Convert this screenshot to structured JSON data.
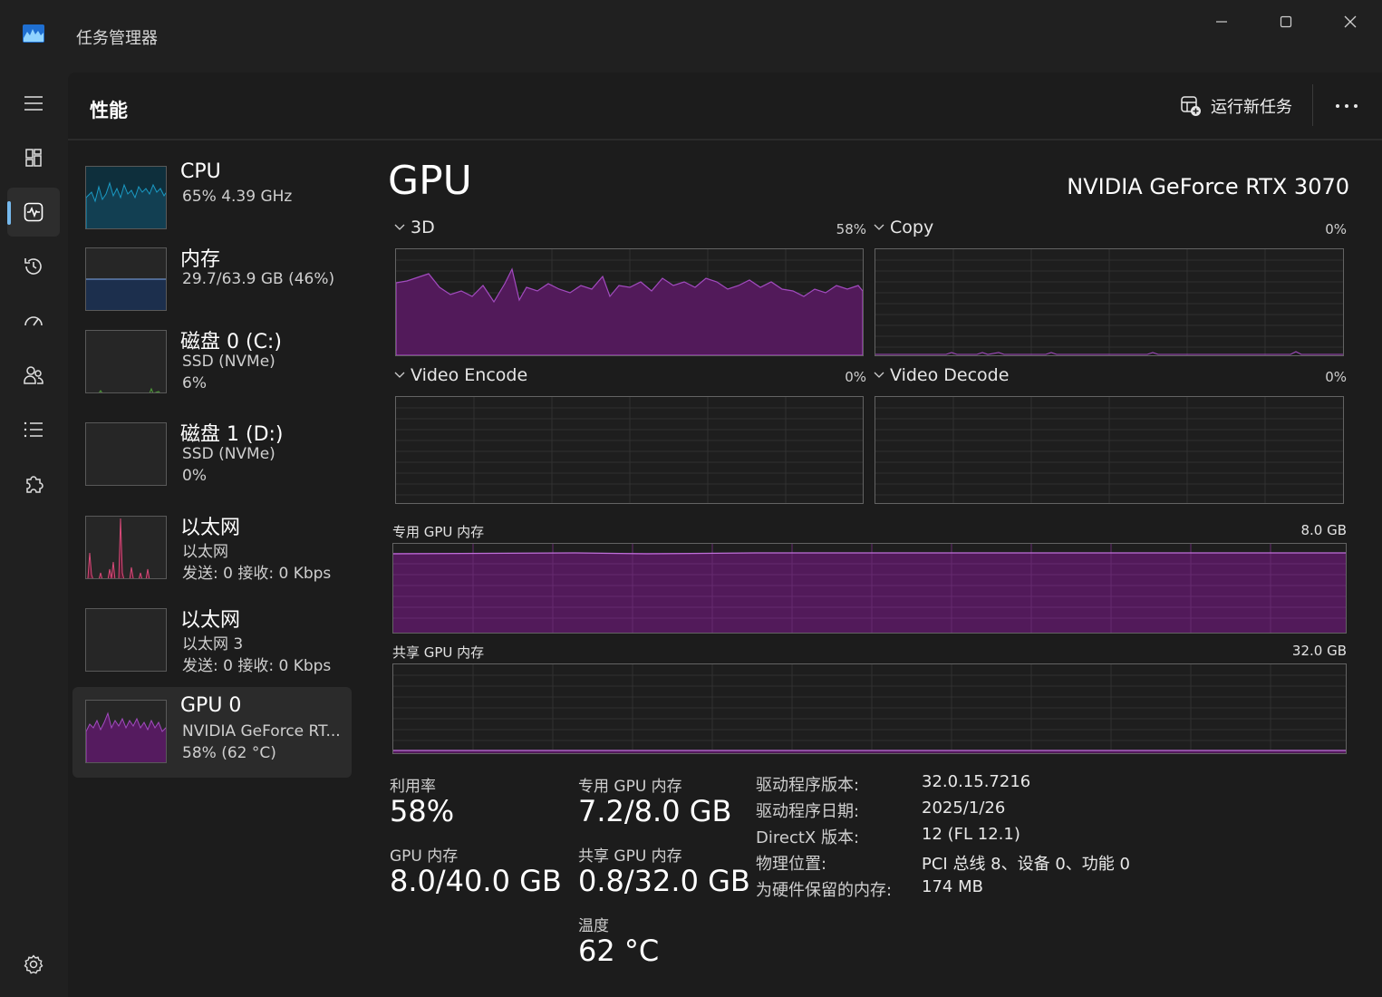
{
  "app": {
    "title": "任务管理器"
  },
  "header": {
    "page_title": "性能",
    "run_new_task": "运行新任务"
  },
  "colors": {
    "gpu": "#a24bbf",
    "gpu_fill": "#551b5f",
    "cpu": "#1a9ac4",
    "memory": "#6b8fc7",
    "disk": "#4fa038",
    "ethernet": "#d94a79",
    "nav_accent": "#76b9ed"
  },
  "devices": [
    {
      "name": "CPU",
      "sub1": "65%  4.39 GHz",
      "sub2": ""
    },
    {
      "name": "内存",
      "sub1": "29.7/63.9 GB (46%)",
      "sub2": ""
    },
    {
      "name": "磁盘 0 (C:)",
      "sub1": "SSD (NVMe)",
      "sub2": "6%"
    },
    {
      "name": "磁盘 1 (D:)",
      "sub1": "SSD (NVMe)",
      "sub2": "0%"
    },
    {
      "name": "以太网",
      "sub1": "以太网",
      "sub2": "发送: 0  接收: 0 Kbps"
    },
    {
      "name": "以太网",
      "sub1": "以太网 3",
      "sub2": "发送: 0  接收: 0 Kbps"
    },
    {
      "name": "GPU 0",
      "sub1": "NVIDIA GeForce RT...",
      "sub2": "58% (62 °C)"
    }
  ],
  "gpu": {
    "title": "GPU",
    "model": "NVIDIA GeForce RTX 3070",
    "engines": [
      {
        "name": "3D",
        "percent": "58%"
      },
      {
        "name": "Copy",
        "percent": "0%"
      },
      {
        "name": "Video Encode",
        "percent": "0%"
      },
      {
        "name": "Video Decode",
        "percent": "0%"
      }
    ],
    "dedicated_memory": {
      "label": "专用 GPU 内存",
      "max": "8.0 GB"
    },
    "shared_memory": {
      "label": "共享 GPU 内存",
      "max": "32.0 GB"
    },
    "stats": {
      "utilization": {
        "label": "利用率",
        "value": "58%"
      },
      "gpu_memory": {
        "label": "GPU 内存",
        "value": "8.0/40.0 GB"
      },
      "dedicated": {
        "label": "专用 GPU 内存",
        "value": "7.2/8.0 GB"
      },
      "shared": {
        "label": "共享 GPU 内存",
        "value": "0.8/32.0 GB"
      },
      "temperature": {
        "label": "温度",
        "value": "62 °C"
      }
    },
    "info": [
      {
        "key": "驱动程序版本:",
        "value": "32.0.15.7216"
      },
      {
        "key": "驱动程序日期:",
        "value": "2025/1/26"
      },
      {
        "key": "DirectX 版本:",
        "value": "12 (FL 12.1)"
      },
      {
        "key": "物理位置:",
        "value": "PCI 总线 8、设备 0、功能 0"
      },
      {
        "key": "为硬件保留的内存:",
        "value": "174 MB"
      }
    ]
  }
}
